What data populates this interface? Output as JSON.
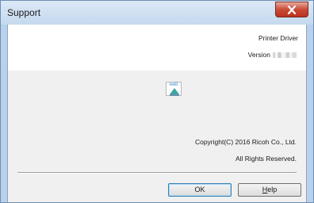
{
  "window": {
    "title": "Support"
  },
  "header": {
    "product": "Printer Driver",
    "version_label": "Version"
  },
  "icons": {
    "web": "web-icon",
    "web_text": "web",
    "close": "close-icon"
  },
  "footer": {
    "copyright": "Copyright(C) 2016 Ricoh Co., Ltd.",
    "rights": "All Rights Reserved."
  },
  "buttons": {
    "ok_label": "OK",
    "help_mnemonic": "H",
    "help_rest": "elp"
  },
  "colors": {
    "titlebar": "#c5d9ee",
    "close_button": "#c94a37",
    "dialog_background": "#f0f0f0",
    "web_icon_accent": "#3aa7a0"
  }
}
